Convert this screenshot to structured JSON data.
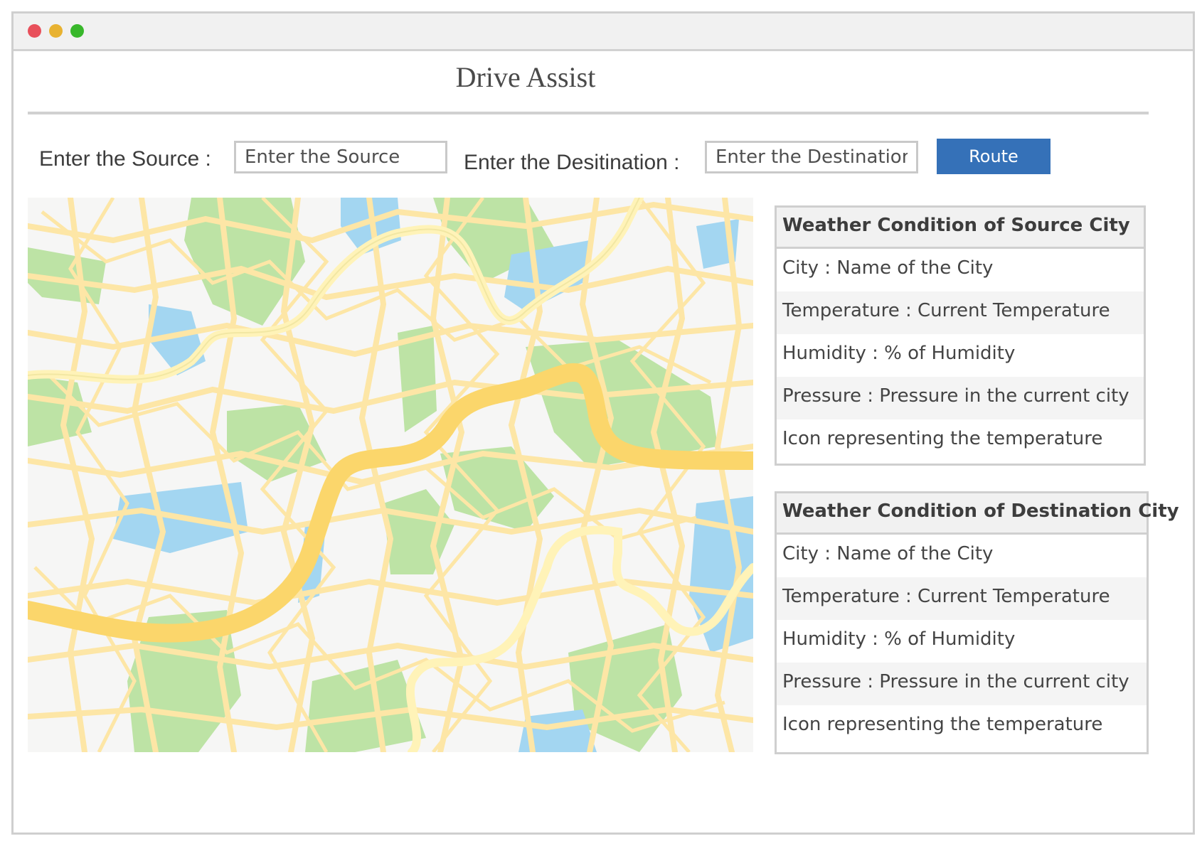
{
  "window": {
    "controls": [
      "close",
      "minimize",
      "maximize"
    ]
  },
  "app": {
    "title": "Drive Assist"
  },
  "form": {
    "source_label": "Enter the Source :",
    "source_placeholder": "Enter the Source",
    "destination_label": "Enter the Desitination :",
    "destination_placeholder": "Enter the Destination",
    "route_button": "Route"
  },
  "colors": {
    "accent": "#3571b8",
    "map_road": "#fde6a6",
    "map_major_road": "#fbd66b",
    "map_park": "#bde3a5",
    "map_water": "#a3d6f1"
  },
  "source_weather": {
    "heading": "Weather Condition of Source City",
    "rows": [
      "City : Name of the City",
      "Temperature : Current Temperature",
      "Humidity : % of Humidity",
      "Pressure : Pressure in the current city",
      "Icon representing the  temperature"
    ]
  },
  "destination_weather": {
    "heading": "Weather Condition of Destination City",
    "rows": [
      "City : Name of the City",
      "Temperature : Current Temperature",
      "Humidity : % of Humidity",
      "Pressure : Pressure in the current city",
      "Icon representing the  temperature"
    ]
  }
}
